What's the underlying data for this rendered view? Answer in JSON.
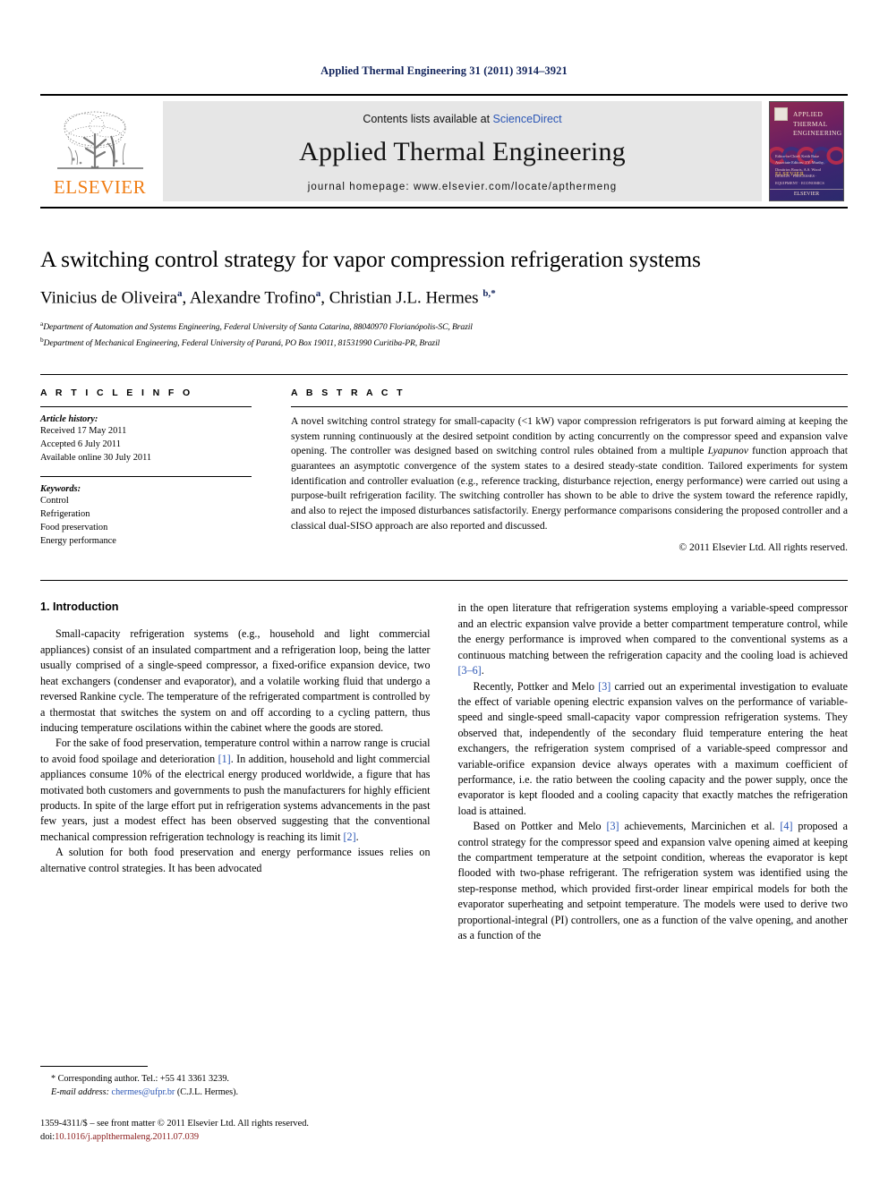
{
  "running_head": "Applied Thermal Engineering 31 (2011) 3914–3921",
  "masthead": {
    "contents_prefix": "Contents lists available at ",
    "sciencedirect": "ScienceDirect",
    "journal_title": "Applied Thermal Engineering",
    "homepage": "journal homepage: www.elsevier.com/locate/apthermeng",
    "publisher_wordmark": "ELSEVIER",
    "cover": {
      "line1": "APPLIED",
      "line2": "THERMAL",
      "line3": "ENGINEERING",
      "editors_note": "Editor-in-Chief: Keith Ruse",
      "editors_list": "Associate Editors: J.Y. Murthy, Dimitrios Bouris, A.S. Wood",
      "topics": "DESIGN · PROCESSES · EQUIPMENT · ECONOMICS",
      "highlight": "ELSEVIER",
      "brand": "ELSEVIER"
    }
  },
  "article": {
    "title": "A switching control strategy for vapor compression refrigeration systems",
    "authors": [
      {
        "name": "Vinicius de Oliveira",
        "marks": "a"
      },
      {
        "name": "Alexandre Trofino",
        "marks": "a"
      },
      {
        "name": "Christian J.L. Hermes",
        "marks": "b,"
      }
    ],
    "affiliations": [
      {
        "mark": "a",
        "text": "Department of Automation and Systems Engineering, Federal University of Santa Catarina, 88040970 Florianópolis-SC, Brazil"
      },
      {
        "mark": "b",
        "text": "Department of Mechanical Engineering, Federal University of Paraná, PO Box 19011, 81531990 Curitiba-PR, Brazil"
      }
    ]
  },
  "article_info": {
    "heading": "A R T I C L E   I N F O",
    "history_label": "Article history:",
    "history": [
      "Received 17 May 2011",
      "Accepted 6 July 2011",
      "Available online 30 July 2011"
    ],
    "keywords_label": "Keywords:",
    "keywords": [
      "Control",
      "Refrigeration",
      "Food preservation",
      "Energy performance"
    ]
  },
  "abstract": {
    "heading": "A B S T R A C T",
    "part1": "A novel switching control strategy for small-capacity (<1 kW) vapor compression refrigerators is put forward aiming at keeping the system running continuously at the desired setpoint condition by acting concurrently on the compressor speed and expansion valve opening. The controller was designed based on switching control rules obtained from a multiple ",
    "italic": "Lyapunov",
    "part2": " function approach that guarantees an asymptotic convergence of the system states to a desired steady-state condition. Tailored experiments for system identification and controller evaluation (e.g., reference tracking, disturbance rejection, energy performance) were carried out using a purpose-built refrigeration facility. The switching controller has shown to be able to drive the system toward the reference rapidly, and also to reject the imposed disturbances satisfactorily. Energy performance comparisons considering the proposed controller and a classical dual-SISO approach are also reported and discussed.",
    "copyright": "© 2011 Elsevier Ltd. All rights reserved."
  },
  "body": {
    "section_title": "1. Introduction",
    "left": {
      "p1": "Small-capacity refrigeration systems (e.g., household and light commercial appliances) consist of an insulated compartment and a refrigeration loop, being the latter usually comprised of a single-speed compressor, a fixed-orifice expansion device, two heat exchangers (condenser and evaporator), and a volatile working fluid that undergo a reversed Rankine cycle. The temperature of the refrigerated compartment is controlled by a thermostat that switches the system on and off according to a cycling pattern, thus inducing temperature oscilations within the cabinet where the goods are stored.",
      "p2a": "For the sake of food preservation, temperature control within a narrow range is crucial to avoid food spoilage and deterioration ",
      "p2_cite1": "[1]",
      "p2b": ". In addition, household and light commercial appliances consume 10% of the electrical energy produced worldwide, a figure that has motivated both customers and governments to push the manufacturers for highly efficient products. In spite of the large effort put in refrigeration systems advancements in the past few years, just a modest effect has been observed suggesting that the conventional mechanical compression refrigeration technology is reaching its limit ",
      "p2_cite2": "[2]",
      "p2c": ".",
      "p3": "A solution for both food preservation and energy performance issues relies on alternative control strategies. It has been advocated"
    },
    "right": {
      "p1a": "in the open literature that refrigeration systems employing a variable-speed compressor and an electric expansion valve provide a better compartment temperature control, while the energy performance is improved when compared to the conventional systems as a continuous matching between the refrigeration capacity and the cooling load is achieved ",
      "p1_cite": "[3–6]",
      "p1b": ".",
      "p2a": "Recently, Pottker and Melo ",
      "p2_cite": "[3]",
      "p2b": " carried out an experimental investigation to evaluate the effect of variable opening electric expansion valves on the performance of variable-speed and single-speed small-capacity vapor compression refrigeration systems. They observed that, independently of the secondary fluid temperature entering the heat exchangers, the refrigeration system comprised of a variable-speed compressor and variable-orifice expansion device always operates with a maximum coefficient of performance, i.e. the ratio between the cooling capacity and the power supply, once the evaporator is kept flooded and a cooling capacity that exactly matches the refrigeration load is attained.",
      "p3a": "Based on Pottker and Melo ",
      "p3_cite1": "[3]",
      "p3b": " achievements, Marcinichen et al. ",
      "p3_cite2": "[4]",
      "p3c": " proposed a control strategy for the compressor speed and expansion valve opening aimed at keeping the compartment temperature at the setpoint condition, whereas the evaporator is kept flooded with two-phase refrigerant. The refrigeration system was identified using the step-response method, which provided first-order linear empirical models for both the evaporator superheating and setpoint temperature. The models were used to derive two proportional-integral (PI) controllers, one as a function of the valve opening, and another as a function of the"
    }
  },
  "footnotes": {
    "corresponding": "* Corresponding author. Tel.: +55 41 3361 3239.",
    "email_label": "E-mail address:",
    "email": "chermes@ufpr.br",
    "email_owner": "(C.J.L. Hermes).",
    "issn_line": "1359-4311/$ – see front matter © 2011 Elsevier Ltd. All rights reserved.",
    "doi_label": "doi:",
    "doi": "10.1016/j.applthermaleng.2011.07.039"
  },
  "colors": {
    "link": "#2b56b5",
    "running_head": "#12245c",
    "elsevier_orange": "#f07d14",
    "doi_red": "#8a1a1a"
  }
}
